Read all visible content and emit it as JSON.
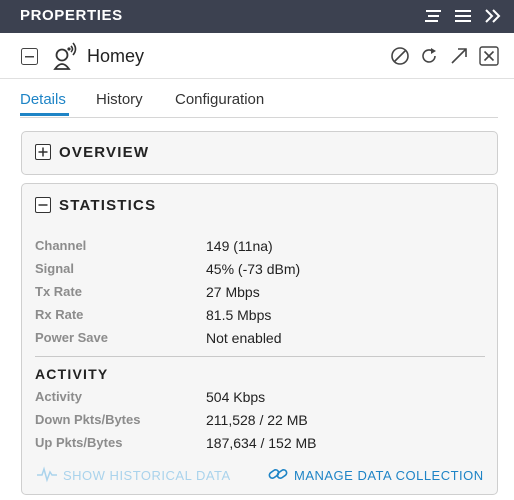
{
  "topbar": {
    "title": "PROPERTIES"
  },
  "header": {
    "device_name": "Homey"
  },
  "tabs": [
    {
      "label": "Details"
    },
    {
      "label": "History"
    },
    {
      "label": "Configuration"
    }
  ],
  "overview": {
    "title": "OVERVIEW"
  },
  "statistics": {
    "title": "STATISTICS",
    "rows": [
      {
        "key": "Channel",
        "value": "149 (11na)"
      },
      {
        "key": "Signal",
        "value": "45% (-73 dBm)"
      },
      {
        "key": "Tx Rate",
        "value": "27 Mbps"
      },
      {
        "key": "Rx Rate",
        "value": "81.5 Mbps"
      },
      {
        "key": "Power Save",
        "value": "Not enabled"
      }
    ]
  },
  "activity": {
    "title": "ACTIVITY",
    "rows": [
      {
        "key": "Activity",
        "value": "504 Kbps"
      },
      {
        "key": "Down Pkts/Bytes",
        "value": "211,528 / 22 MB"
      },
      {
        "key": "Up Pkts/Bytes",
        "value": "187,634 / 152 MB"
      }
    ]
  },
  "links": {
    "historical": "SHOW HISTORICAL DATA",
    "manage": "MANAGE DATA COLLECTION"
  },
  "colors": {
    "topbar_bg": "#3c4150",
    "accent": "#1e84c6",
    "disabled_link": "#aad3ec"
  }
}
